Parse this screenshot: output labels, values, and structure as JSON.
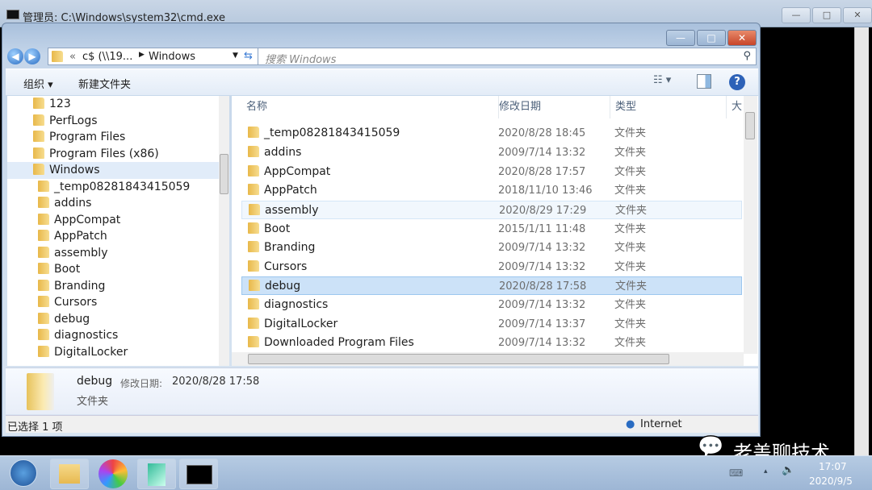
{
  "cmd": {
    "title": "管理员: C:\\Windows\\system32\\cmd.exe"
  },
  "explorer": {
    "address": {
      "prefix": "«",
      "path_1": "c$ (\\\\19...",
      "path_2": "Windows"
    },
    "search": {
      "placeholder": "搜索 Windows"
    },
    "toolbar": {
      "organize": "组织 ▾",
      "new_folder": "新建文件夹",
      "help": "?"
    },
    "nav": [
      {
        "label": "123"
      },
      {
        "label": "PerfLogs"
      },
      {
        "label": "Program Files"
      },
      {
        "label": "Program Files (x86)"
      },
      {
        "label": "Windows"
      },
      {
        "label": "_temp08281843415059"
      },
      {
        "label": "addins"
      },
      {
        "label": "AppCompat"
      },
      {
        "label": "AppPatch"
      },
      {
        "label": "assembly"
      },
      {
        "label": "Boot"
      },
      {
        "label": "Branding"
      },
      {
        "label": "Cursors"
      },
      {
        "label": "debug"
      },
      {
        "label": "diagnostics"
      },
      {
        "label": "DigitalLocker"
      }
    ],
    "columns": {
      "name": "名称",
      "date": "修改日期",
      "type": "类型",
      "size": "大"
    },
    "rows": [
      {
        "name": "_temp08281843415059",
        "date": "2020/8/28 18:45",
        "type": "文件夹"
      },
      {
        "name": "addins",
        "date": "2009/7/14 13:32",
        "type": "文件夹"
      },
      {
        "name": "AppCompat",
        "date": "2020/8/28 17:57",
        "type": "文件夹"
      },
      {
        "name": "AppPatch",
        "date": "2018/11/10 13:46",
        "type": "文件夹"
      },
      {
        "name": "assembly",
        "date": "2020/8/29 17:29",
        "type": "文件夹"
      },
      {
        "name": "Boot",
        "date": "2015/1/11 11:48",
        "type": "文件夹"
      },
      {
        "name": "Branding",
        "date": "2009/7/14 13:32",
        "type": "文件夹"
      },
      {
        "name": "Cursors",
        "date": "2009/7/14 13:32",
        "type": "文件夹"
      },
      {
        "name": "debug",
        "date": "2020/8/28 17:58",
        "type": "文件夹"
      },
      {
        "name": "diagnostics",
        "date": "2009/7/14 13:32",
        "type": "文件夹"
      },
      {
        "name": "DigitalLocker",
        "date": "2009/7/14 13:37",
        "type": "文件夹"
      },
      {
        "name": "Downloaded Program Files",
        "date": "2009/7/14 13:32",
        "type": "文件夹"
      }
    ],
    "details": {
      "name": "debug",
      "date_label": "修改日期:",
      "date": "2020/8/28 17:58",
      "type": "文件夹"
    },
    "status": {
      "selected": "已选择 1 项",
      "zone": "Internet"
    }
  },
  "watermark": "老盖聊技术",
  "taskbar": {
    "time": "17:07",
    "date": "2020/9/5"
  }
}
